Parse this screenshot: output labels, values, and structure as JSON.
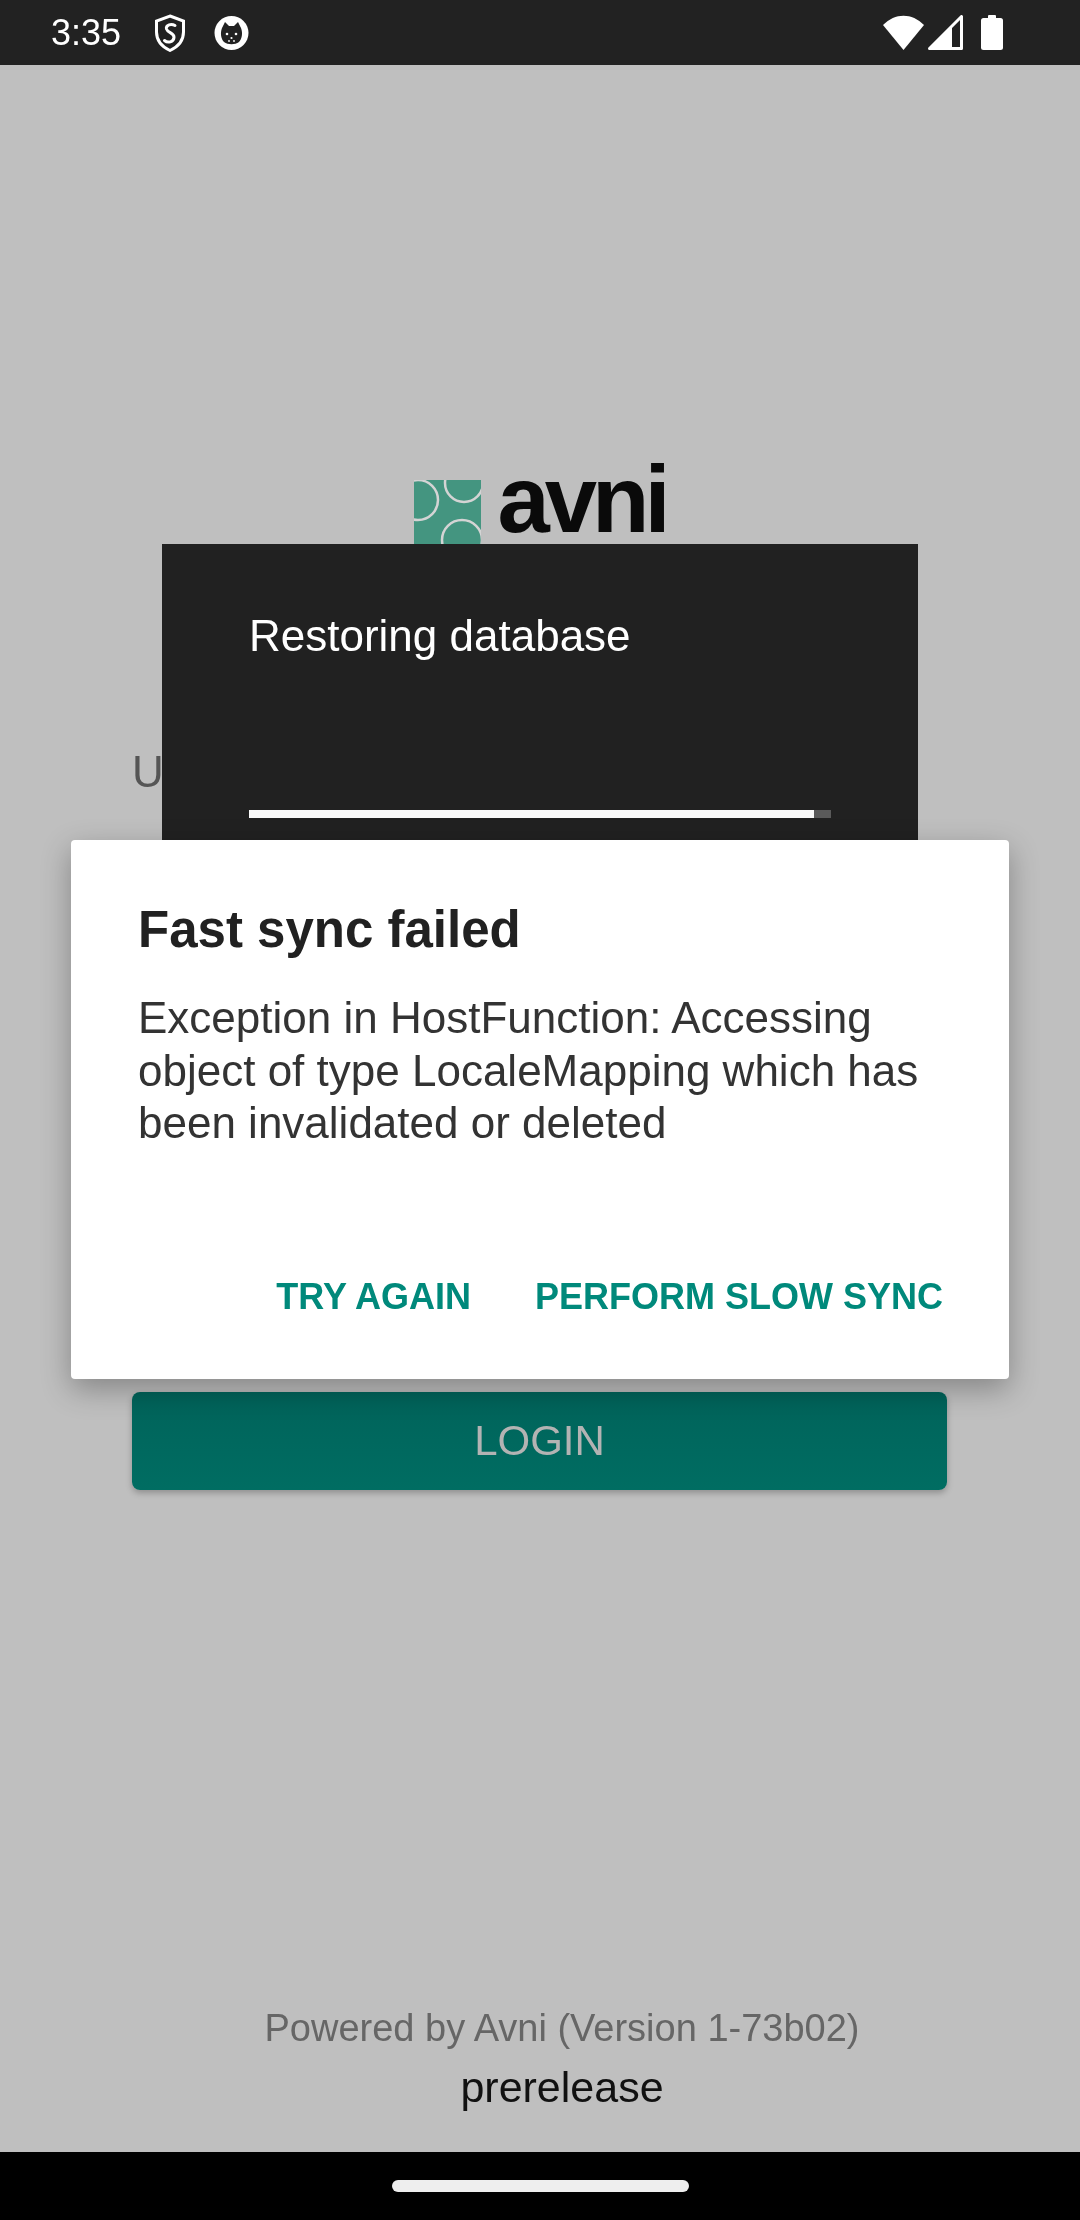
{
  "status_bar": {
    "time": "3:35"
  },
  "login_screen": {
    "logo_text": "avni",
    "field_label": "U",
    "login_button": "LOGIN"
  },
  "progress_dialog": {
    "title": "Restoring database",
    "level": 0.97
  },
  "alert_dialog": {
    "title": "Fast sync failed",
    "message": "Exception in HostFunction: Accessing object of type LocaleMapping which has been invalidated or deleted",
    "buttons": [
      "TRY AGAIN",
      "PERFORM SLOW SYNC"
    ]
  },
  "footer": {
    "powered_by": "Powered by Avni (Version 1-73b02)",
    "build_label": "prerelease"
  }
}
